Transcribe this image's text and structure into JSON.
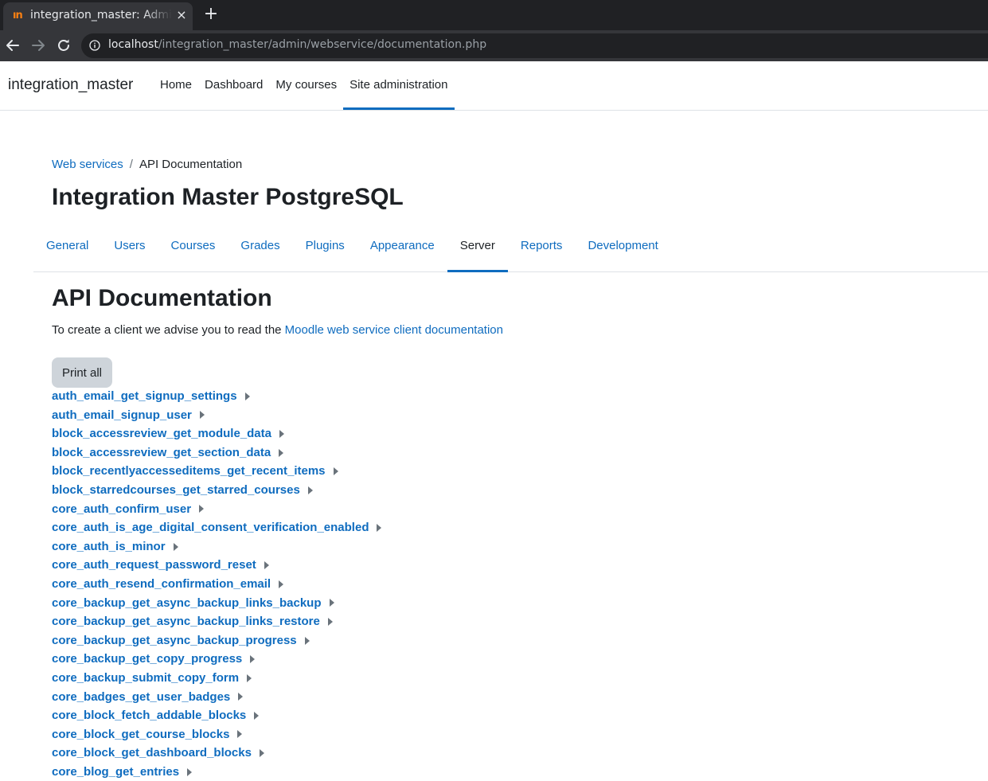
{
  "browser": {
    "tab_title": "integration_master: Administration",
    "tab_favicon": "ın",
    "close_glyph": "×",
    "new_tab_glyph": "+",
    "url_host": "localhost",
    "url_path": "/integration_master/admin/webservice/documentation.php"
  },
  "navbar": {
    "brand": "integration_master",
    "items": [
      {
        "label": "Home"
      },
      {
        "label": "Dashboard"
      },
      {
        "label": "My courses"
      },
      {
        "label": "Site administration",
        "active": true
      }
    ]
  },
  "breadcrumb": {
    "parent": "Web services",
    "separator": "/",
    "current": "API Documentation"
  },
  "page_title": "Integration Master PostgreSQL",
  "admin_tabs": [
    {
      "label": "General"
    },
    {
      "label": "Users"
    },
    {
      "label": "Courses"
    },
    {
      "label": "Grades"
    },
    {
      "label": "Plugins"
    },
    {
      "label": "Appearance"
    },
    {
      "label": "Server",
      "active": true
    },
    {
      "label": "Reports"
    },
    {
      "label": "Development"
    }
  ],
  "content": {
    "heading": "API Documentation",
    "intro_text": "To create a client we advise you to read the ",
    "intro_link": "Moodle web service client documentation",
    "print_all": "Print all"
  },
  "functions": [
    "auth_email_get_signup_settings",
    "auth_email_signup_user",
    "block_accessreview_get_module_data",
    "block_accessreview_get_section_data",
    "block_recentlyaccesseditems_get_recent_items",
    "block_starredcourses_get_starred_courses",
    "core_auth_confirm_user",
    "core_auth_is_age_digital_consent_verification_enabled",
    "core_auth_is_minor",
    "core_auth_request_password_reset",
    "core_auth_resend_confirmation_email",
    "core_backup_get_async_backup_links_backup",
    "core_backup_get_async_backup_links_restore",
    "core_backup_get_async_backup_progress",
    "core_backup_get_copy_progress",
    "core_backup_submit_copy_form",
    "core_badges_get_user_badges",
    "core_block_fetch_addable_blocks",
    "core_block_get_course_blocks",
    "core_block_get_dashboard_blocks",
    "core_blog_get_entries"
  ],
  "colors": {
    "link": "#0f6cbf",
    "text": "#1d2125",
    "chrome_dark": "#202124",
    "chrome_toolbar": "#35363a",
    "button_bg": "#ced4da",
    "favicon": "#f98012"
  }
}
